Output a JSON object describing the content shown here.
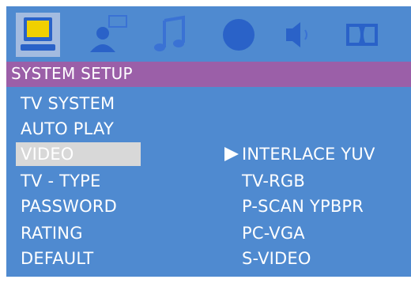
{
  "header": {
    "title": "SYSTEM SETUP"
  },
  "icons": [
    "system-setup-icon",
    "user-icon",
    "music-note-icon",
    "color-icon",
    "speaker-icon",
    "dolby-icon"
  ],
  "menu": {
    "items": [
      {
        "label": "TV SYSTEM"
      },
      {
        "label": "AUTO PLAY"
      },
      {
        "label": "VIDEO"
      },
      {
        "label": "TV - TYPE"
      },
      {
        "label": "PASSWORD"
      },
      {
        "label": "RATING"
      },
      {
        "label": "DEFAULT"
      }
    ]
  },
  "submenu": {
    "items": [
      {
        "label": "INTERLACE YUV"
      },
      {
        "label": "TV-RGB"
      },
      {
        "label": "P-SCAN YPBPR"
      },
      {
        "label": "PC-VGA"
      },
      {
        "label": "S-VIDEO"
      }
    ]
  },
  "colors": {
    "panel": "#4f8ad0",
    "titlebar": "#9b5fa8",
    "selection": "#d8d8d8",
    "icon_blue": "#2a62c8",
    "icon_yellow": "#f0d000"
  }
}
